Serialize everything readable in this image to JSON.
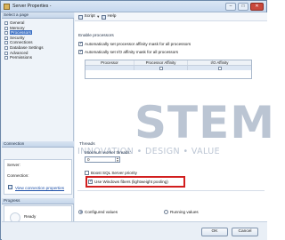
{
  "window": {
    "title": "Server Properties -",
    "min_label": "–",
    "max_label": "□",
    "close_label": "✕"
  },
  "left": {
    "select_page_header": "Select a page",
    "pages": [
      {
        "label": "General"
      },
      {
        "label": "Memory"
      },
      {
        "label": "Processors"
      },
      {
        "label": "Security"
      },
      {
        "label": "Connections"
      },
      {
        "label": "Database Settings"
      },
      {
        "label": "Advanced"
      },
      {
        "label": "Permissions"
      }
    ],
    "connection_header": "Connection",
    "server_label": "Server:",
    "connection_label": "Connection:",
    "view_link": "View connection properties",
    "progress_header": "Progress",
    "ready": "Ready"
  },
  "toolbar": {
    "script_label": "Script",
    "help_label": "Help"
  },
  "main": {
    "enable_processors": "Enable processors",
    "auto_processor_mask": "Automatically set processor affinity mask for all processors",
    "auto_io_mask": "Automatically set I/O affinity mask for all processors",
    "grid_headers": [
      "Processor",
      "Processor Affinity",
      "I/O Affinity"
    ],
    "threads_label": "Threads",
    "max_worker_threads_label": "Maximum worker threads:",
    "max_worker_threads_value": "0",
    "boost_priority": "Boost SQL Server priority",
    "use_fibers": "Use Windows fibers (lightweight pooling)",
    "configured_values": "Configured values",
    "running_values": "Running values"
  },
  "footer": {
    "ok": "OK",
    "cancel": "Cancel"
  },
  "watermark": {
    "brand": "STEM",
    "tagline": "INNOVATION • DESIGN • VALUE"
  },
  "colors": {
    "highlight": "#d21e1e",
    "selected": "#3a6fc4"
  }
}
